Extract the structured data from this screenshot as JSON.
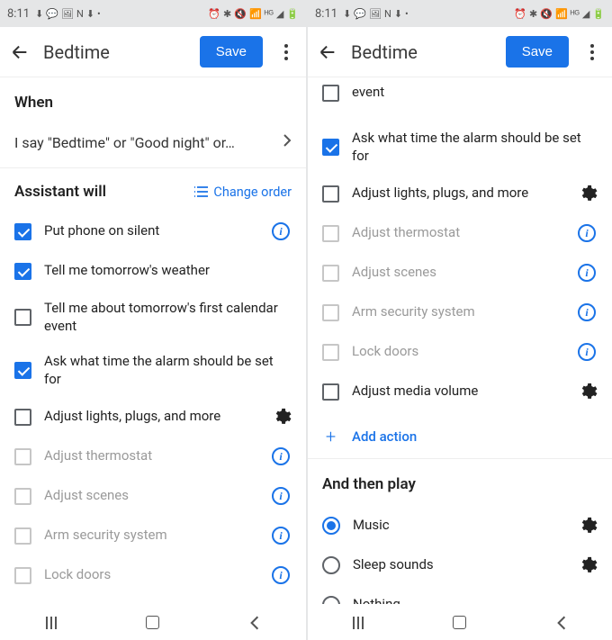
{
  "status": {
    "time": "8:11"
  },
  "appbar": {
    "title": "Bedtime",
    "save": "Save"
  },
  "left": {
    "when_title": "When",
    "trigger_text": "I say \"Bedtime\" or \"Good night\" or…",
    "assistant_title": "Assistant will",
    "change_order": "Change order",
    "items": [
      {
        "label": "Put phone on silent",
        "checked": true,
        "trailing": "info",
        "disabled": false
      },
      {
        "label": "Tell me tomorrow's weather",
        "checked": true,
        "trailing": null,
        "disabled": false
      },
      {
        "label": "Tell me about tomorrow's first calendar event",
        "checked": false,
        "trailing": null,
        "disabled": false
      },
      {
        "label": "Ask what time the alarm should be set for",
        "checked": true,
        "trailing": null,
        "disabled": false
      },
      {
        "label": "Adjust lights, plugs, and more",
        "checked": false,
        "trailing": "gear",
        "disabled": false
      },
      {
        "label": "Adjust thermostat",
        "checked": false,
        "trailing": "info",
        "disabled": true
      },
      {
        "label": "Adjust scenes",
        "checked": false,
        "trailing": "info",
        "disabled": true
      },
      {
        "label": "Arm security system",
        "checked": false,
        "trailing": "info",
        "disabled": true
      },
      {
        "label": "Lock doors",
        "checked": false,
        "trailing": "info",
        "disabled": true
      }
    ]
  },
  "right": {
    "truncated_label": "event",
    "items": [
      {
        "label": "Ask what time the alarm should be set for",
        "checked": true,
        "trailing": null,
        "disabled": false
      },
      {
        "label": "Adjust lights, plugs, and more",
        "checked": false,
        "trailing": "gear",
        "disabled": false
      },
      {
        "label": "Adjust thermostat",
        "checked": false,
        "trailing": "info",
        "disabled": true
      },
      {
        "label": "Adjust scenes",
        "checked": false,
        "trailing": "info",
        "disabled": true
      },
      {
        "label": "Arm security system",
        "checked": false,
        "trailing": "info",
        "disabled": true
      },
      {
        "label": "Lock doors",
        "checked": false,
        "trailing": "info",
        "disabled": true
      },
      {
        "label": "Adjust media volume",
        "checked": false,
        "trailing": "gear",
        "disabled": false
      }
    ],
    "add_action": "Add action",
    "play_title": "And then play",
    "play_options": [
      {
        "label": "Music",
        "selected": true,
        "trailing": "gear"
      },
      {
        "label": "Sleep sounds",
        "selected": false,
        "trailing": "gear"
      },
      {
        "label": "Nothing",
        "selected": false,
        "trailing": null
      }
    ]
  }
}
